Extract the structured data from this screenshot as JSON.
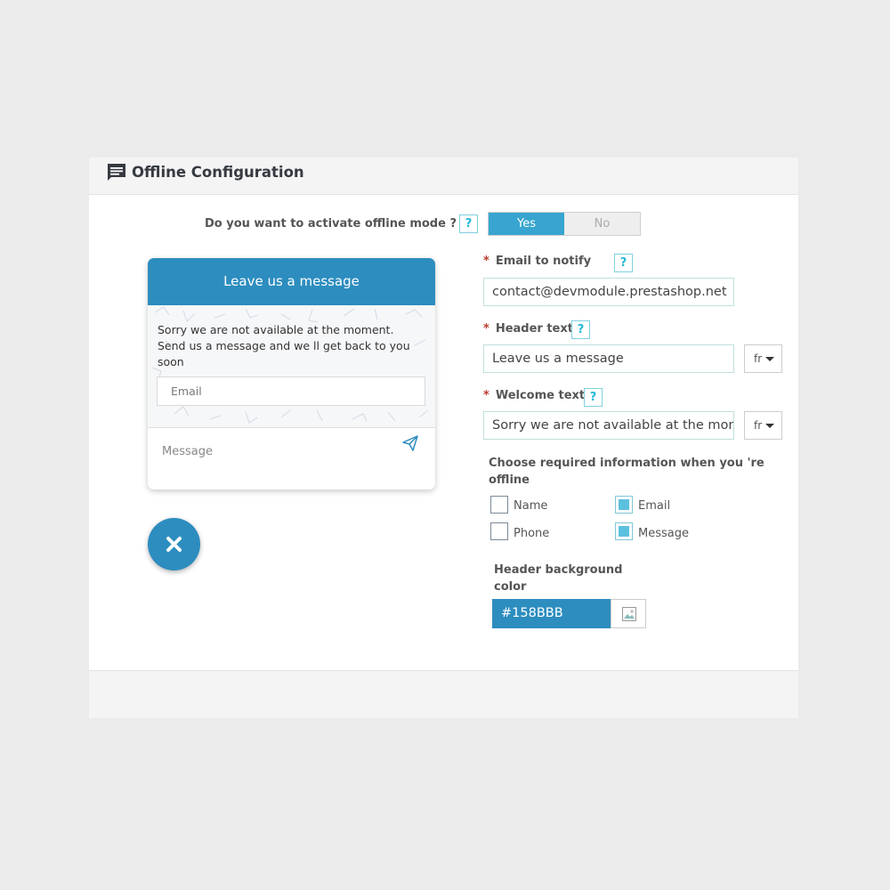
{
  "panel": {
    "title": "Offline Configuration",
    "icon": "message-icon"
  },
  "activate": {
    "question": "Do you want to activate offline mode ?",
    "help": "?",
    "yes_label": "Yes",
    "no_label": "No",
    "selected": "Yes"
  },
  "preview": {
    "header": "Leave us a message",
    "welcome": "Sorry we are not available at the moment. Send us a message and we ll get back to you soon",
    "email_placeholder": "Email",
    "message_placeholder": "Message",
    "send_icon": "send-icon",
    "close_icon": "close-icon"
  },
  "form": {
    "email_label": "Email to notify",
    "email_value": "contact@devmodule.prestashop.net",
    "header_label": "Header text",
    "header_value": "Leave us a message",
    "welcome_label": "Welcome text",
    "welcome_value": "Sorry we are not available at the mom",
    "lang": "fr",
    "required_marker": "*",
    "help": "?"
  },
  "required_info": {
    "title": "Choose required information when you 're offline",
    "options": [
      {
        "label": "Name",
        "checked": false
      },
      {
        "label": "Email",
        "checked": true
      },
      {
        "label": "Phone",
        "checked": false
      },
      {
        "label": "Message",
        "checked": true
      }
    ]
  },
  "header_bg": {
    "label": "Header background color",
    "value": "#158BBB"
  },
  "colors": {
    "accent": "#2d8dbf",
    "switch_on": "#37a5cf",
    "help_border": "#25b9d7",
    "required": "#c0392b"
  }
}
